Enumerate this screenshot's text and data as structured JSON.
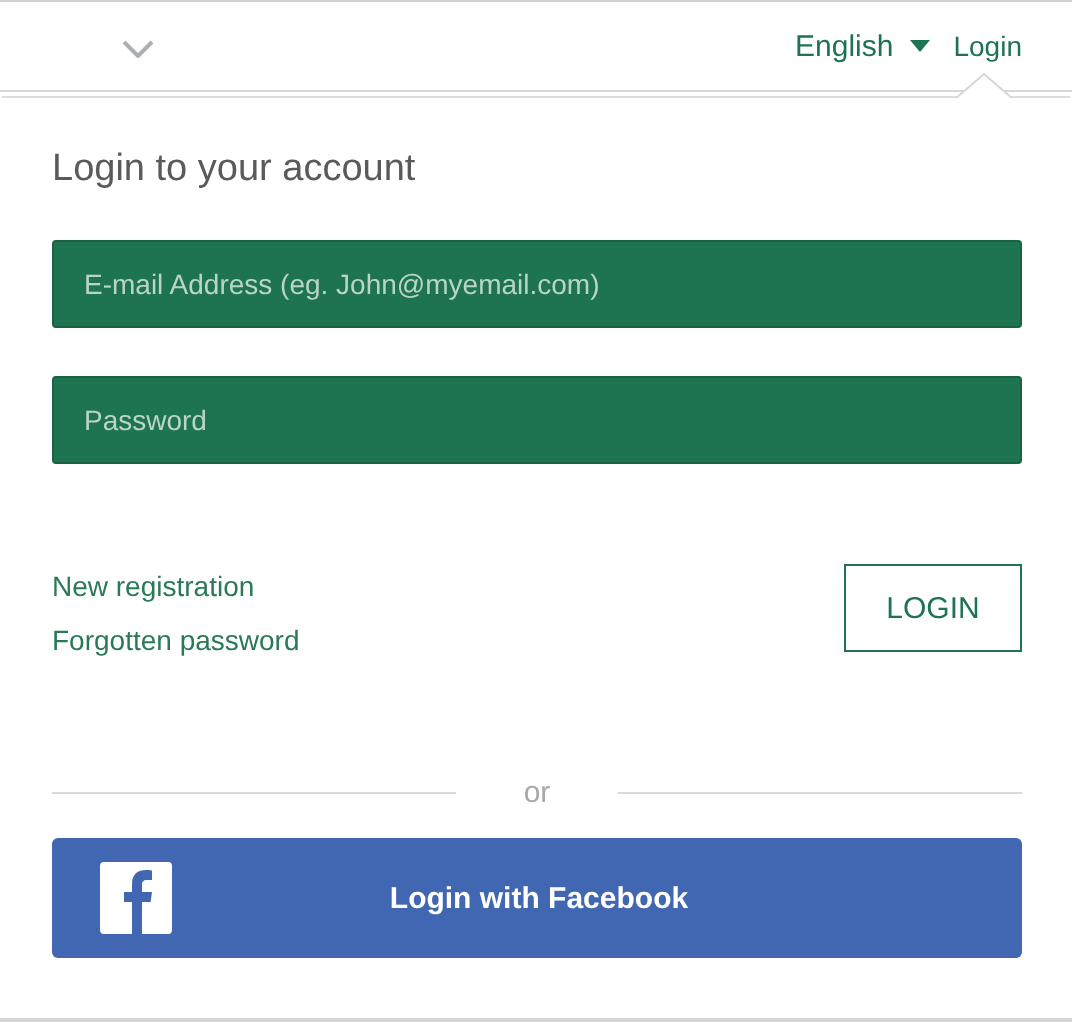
{
  "header": {
    "language": "English",
    "login_link": "Login"
  },
  "title": "Login to your account",
  "fields": [
    {
      "placeholder": "E-mail Address (eg. John@myemail.com)"
    },
    {
      "placeholder": "Password"
    }
  ],
  "links": [
    "New registration",
    "Forgotten password"
  ],
  "login_button": "LOGIN",
  "divider": "or",
  "facebook_button": "Login with Facebook"
}
